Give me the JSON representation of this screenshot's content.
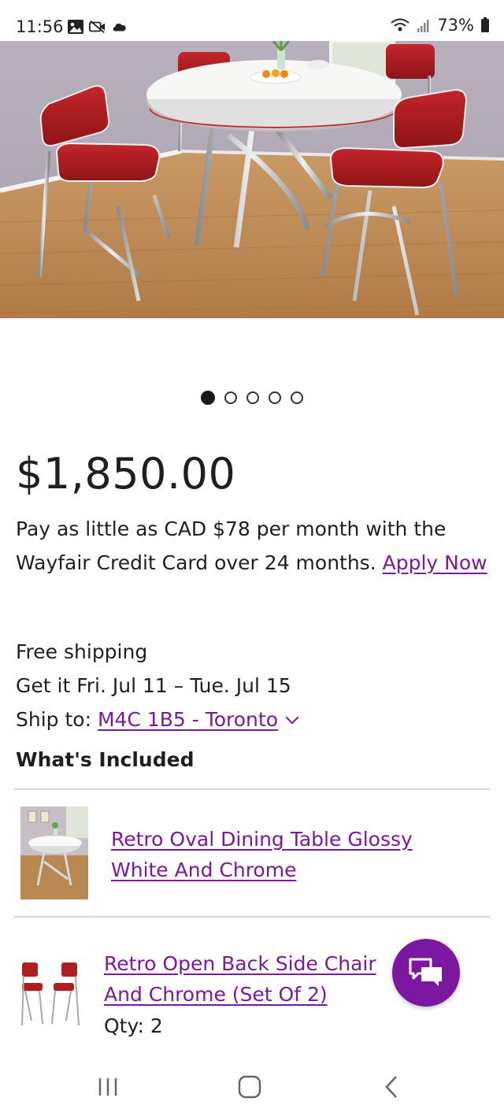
{
  "status_bar": {
    "time": "11:56",
    "battery": "73%",
    "icons_left": [
      "gallery-icon",
      "video-camera-off-icon",
      "cloud-icon"
    ],
    "icons_right": [
      "wifi-icon",
      "signal-icon",
      "battery-icon"
    ]
  },
  "hero": {
    "image": "retro-dining-set-photo",
    "carousel": {
      "total": 5,
      "active": 1
    }
  },
  "product": {
    "price": "$1,850.00",
    "credit_text": "Pay as little as CAD $78 per month with the Wayfair Credit Card over 24 months.",
    "apply_now": "Apply Now"
  },
  "shipping": {
    "free_shipping": "Free shipping",
    "delivery": "Get it Fri. Jul 11 – Tue. Jul 15",
    "ship_to_label": "Ship to:",
    "ship_to_value": "M4C 1B5 - Toronto"
  },
  "included": {
    "title": "What's Included",
    "items": [
      {
        "title": "Retro Oval Dining Table Glossy White And Chrome",
        "qty": ""
      },
      {
        "title": "Retro Open Back Side Chair And Chrome (Set Of 2)",
        "qty": "Qty: 2"
      }
    ]
  },
  "colors": {
    "accent": "#7b189f",
    "text": "#1f1f1f",
    "divider": "#d6d6d6"
  }
}
